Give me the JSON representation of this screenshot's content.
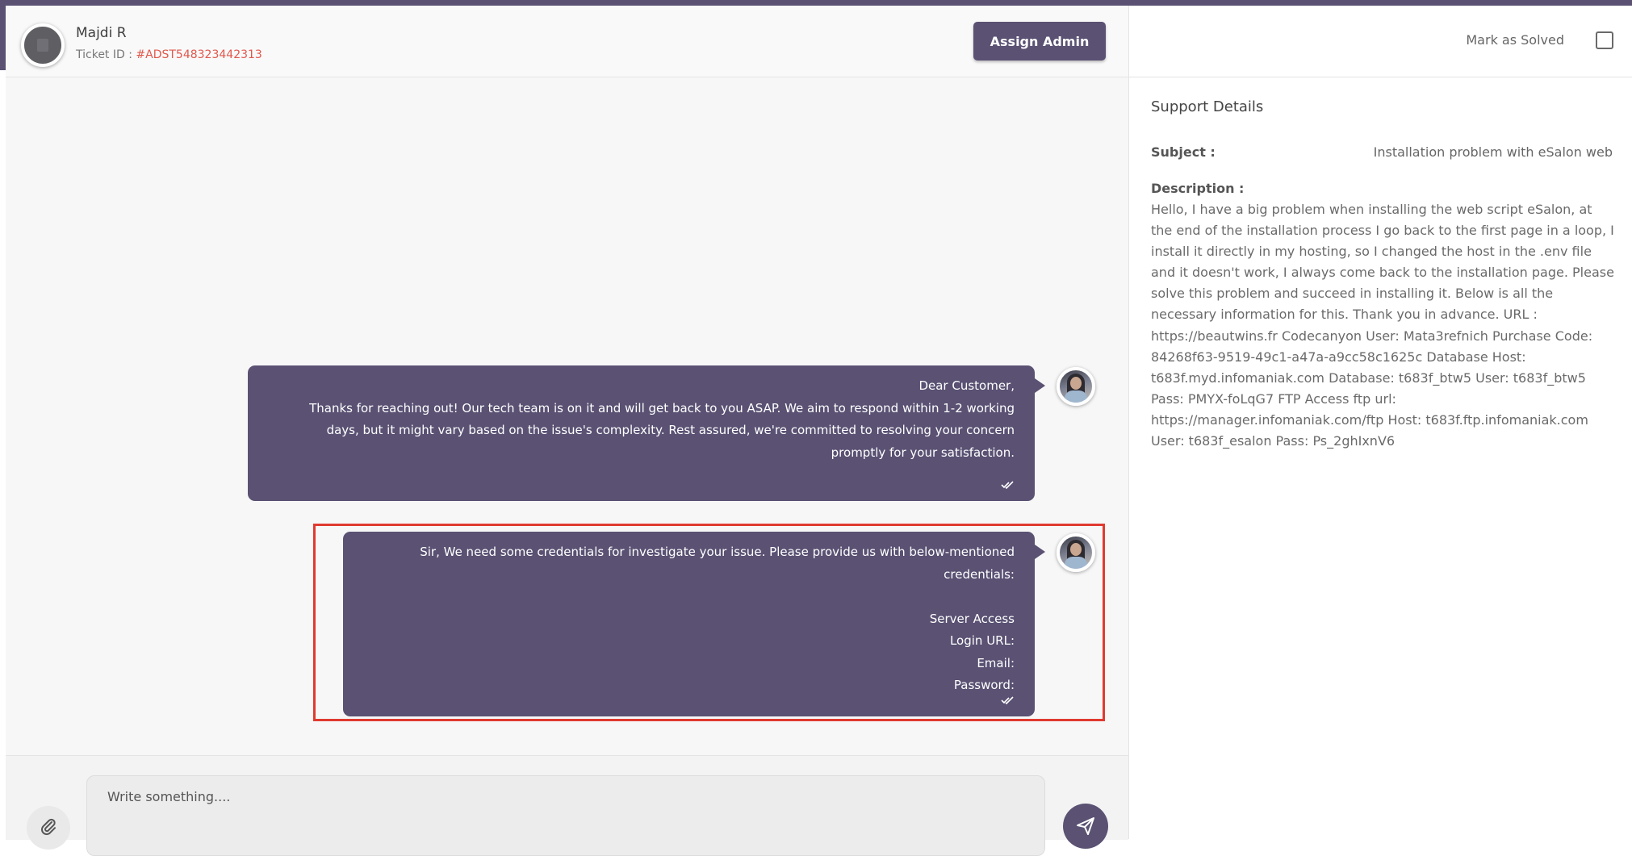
{
  "header": {
    "user_name": "Majdi R",
    "ticket_label": "Ticket ID : ",
    "ticket_id": "#ADST548323442313",
    "assign_button": "Assign Admin"
  },
  "messages": [
    {
      "lines": [
        "Dear Customer,",
        "Thanks for reaching out! Our tech team is on it and will get back to you ASAP. We aim to respond within 1-2 working days, but it might vary based on the issue's complexity. Rest assured, we're committed to resolving your concern promptly for your satisfaction."
      ],
      "status_icon": "double-check-icon"
    },
    {
      "lines": [
        "Sir, We need some credentials for investigate your issue. Please provide us with below-mentioned credentials:",
        "",
        "Server Access",
        "Login URL:",
        "Email:",
        "Password:"
      ],
      "status_icon": "double-check-icon",
      "highlighted": true
    }
  ],
  "composer": {
    "placeholder": "Write something....",
    "attach_icon": "paperclip-icon",
    "send_icon": "send-icon"
  },
  "details": {
    "mark_solved_label": "Mark as Solved",
    "mark_solved_checked": false,
    "title": "Support Details",
    "subject_label": "Subject :",
    "subject_value": "Installation problem with eSalon web",
    "description_label": "Description :",
    "description": "Hello, I have a big problem when installing the web script eSalon, at the end of the installation process I go back to the first page in a loop, I install it directly in my hosting, so I changed the host in the .env file and it doesn't work, I always come back to the installation page. Please solve this problem and succeed in installing it. Below is all the necessary information for this. Thank you in advance. URL : https://beautwins.fr Codecanyon User: Mata3refnich Purchase Code: 84268f63-9519-49c1-a47a-a9cc58c1625c Database Host: t683f.myd.infomaniak.com Database: t683f_btw5 User: t683f_btw5 Pass: PMYX-foLqG7 FTP Access ftp url: https://manager.infomaniak.com/ftp Host: t683f.ftp.infomaniak.com User: t683f_esalon Pass: Ps_2ghIxnV6"
  },
  "colors": {
    "accent": "#5a5173",
    "ticket_id": "#e2574c",
    "highlight_border": "#e03a30"
  }
}
